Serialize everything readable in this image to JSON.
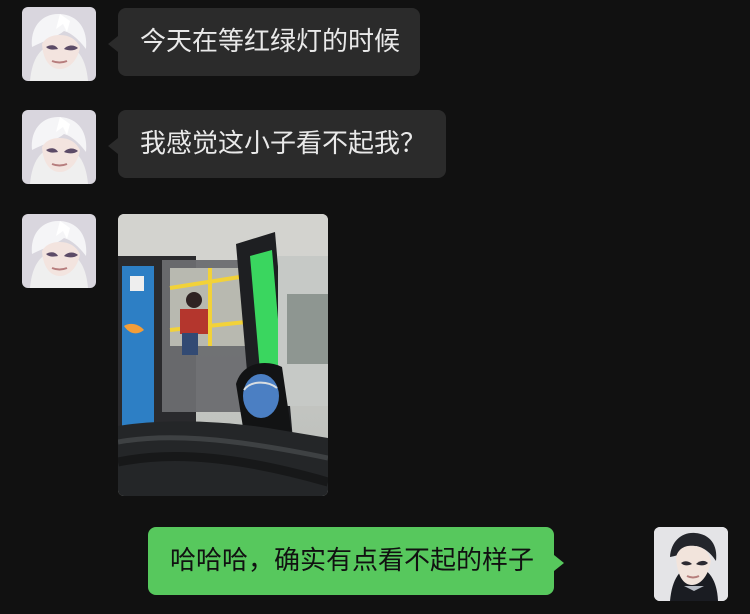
{
  "messages": [
    {
      "side": "left",
      "avatar": "anime-boy-avatar",
      "text": "今天在等红绿灯的时候"
    },
    {
      "side": "left",
      "avatar": "anime-boy-avatar",
      "text": "我感觉这小子看不起我？"
    },
    {
      "side": "left",
      "avatar": "anime-boy-avatar",
      "image": "bus-photo"
    },
    {
      "side": "right",
      "avatar": "anime-boy-avatar-2",
      "text": "哈哈哈，确实有点看不起的样子"
    }
  ],
  "colors": {
    "background": "#111111",
    "incoming_bubble": "#2b2b2b",
    "outgoing_bubble": "#57c85d"
  }
}
